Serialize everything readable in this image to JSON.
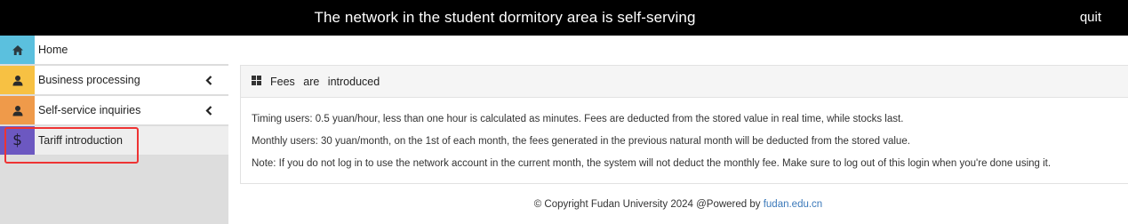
{
  "header": {
    "title": "The network in the student dormitory area is self-serving",
    "quit_label": "quit"
  },
  "sidebar": {
    "items": [
      {
        "label": "Home",
        "icon": "home-icon",
        "color": "#5bc0de",
        "has_submenu": false
      },
      {
        "label": "Business processing",
        "icon": "user-icon",
        "color": "#f7c143",
        "has_submenu": true
      },
      {
        "label": "Self-service inquiries",
        "icon": "user-icon",
        "color": "#ef9a4a",
        "has_submenu": true
      },
      {
        "label": "Tariff introduction",
        "icon": "dollar-icon",
        "color": "#6c58c1",
        "has_submenu": false
      }
    ]
  },
  "panel": {
    "title": "Fees   are   introduced",
    "paragraphs": [
      "Timing users: 0.5 yuan/hour, less than one hour is calculated as minutes. Fees are deducted from the stored value in real time, while stocks last.",
      "Monthly users: 30 yuan/month, on the 1st of each month, the fees generated in the previous natural month will be deducted from the stored value.",
      "Note: If you do not log in to use the network account in the current month, the system will not deduct the monthly fee. Make sure to log out of this login when you're done using it."
    ]
  },
  "footer": {
    "copyright": "© Copyright Fudan University 2024 @Powered by ",
    "link": "fudan.edu.cn"
  }
}
